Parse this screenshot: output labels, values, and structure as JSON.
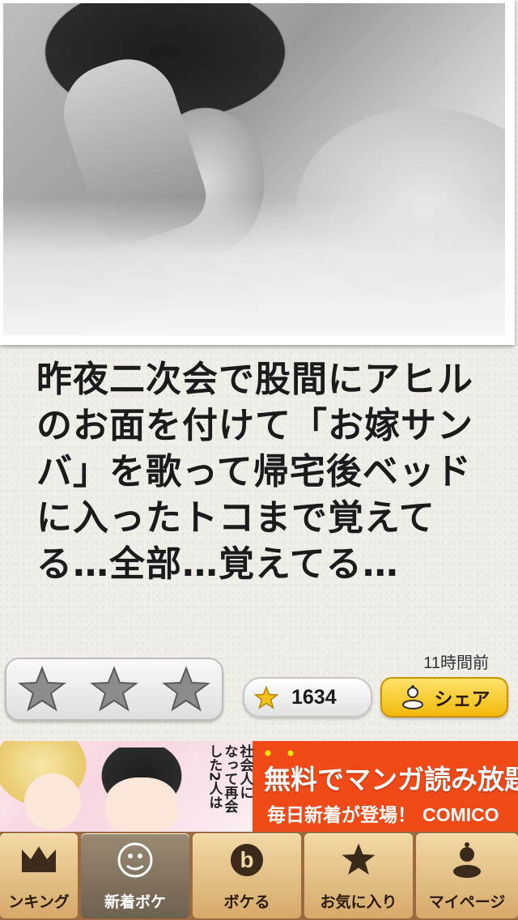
{
  "post": {
    "text": "昨夜二次会で股間にアヒルのお面を付けて「お嫁サンバ」を歌って帰宅後ベッドに入ったトコまで覚えてる…全部…覚えてる…",
    "timestamp": "11時間前",
    "rating_icon": "star-icon",
    "count": "1634",
    "share_label": "シェア"
  },
  "ad": {
    "vertical_lines": [
      "社会人に",
      "なって再会",
      "した2人は"
    ],
    "title": "無料でマンガ読み放題",
    "subtitle": "毎日新着が登場！",
    "brand": "COMICO",
    "background_color": "#f04a18"
  },
  "tabs": [
    {
      "label": "ンキング",
      "icon": "crown-icon"
    },
    {
      "label": "新着ボケ",
      "icon": "new-boke-icon"
    },
    {
      "label": "ボケる",
      "icon": "b-icon"
    },
    {
      "label": "お気に入り",
      "icon": "star-icon"
    },
    {
      "label": "マイページ",
      "icon": "person-icon"
    }
  ],
  "active_tab": 1
}
